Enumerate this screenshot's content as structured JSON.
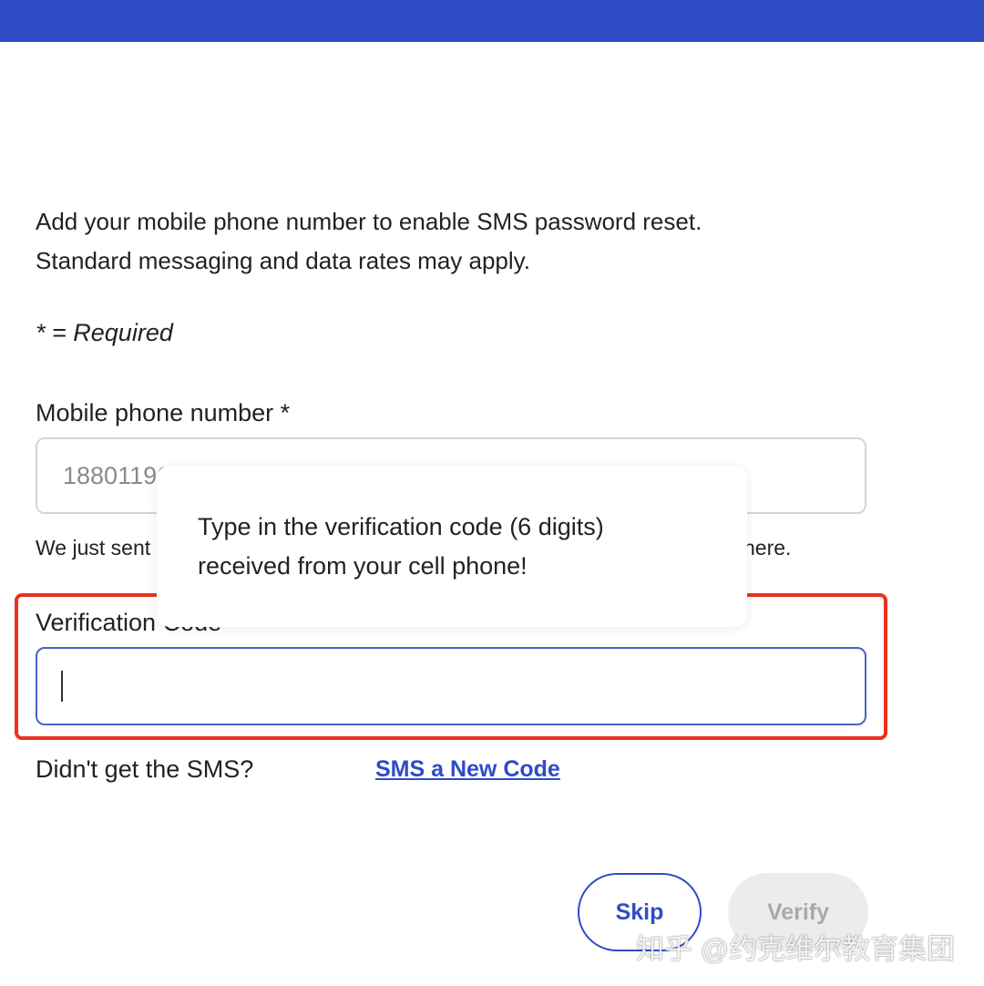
{
  "colors": {
    "brand": "#2f4cc5",
    "highlight": "#e8321f",
    "disabled_bg": "#ececec"
  },
  "intro": {
    "line1": "Add your mobile phone number to enable SMS password reset.",
    "line2": "Standard messaging and data rates may apply."
  },
  "required_note": "* = Required",
  "phone_field": {
    "label": "Mobile phone number *",
    "value": "18801196"
  },
  "hint": {
    "start": "We just sent",
    "end": "here."
  },
  "code_field": {
    "label": "Verification Code *",
    "value": ""
  },
  "tooltip": {
    "line1": "Type in the verification code (6 digits)",
    "line2": "received from your cell phone!"
  },
  "resend": {
    "question": "Didn't get the SMS?",
    "link": "SMS a New Code"
  },
  "buttons": {
    "skip": "Skip",
    "verify": "Verify"
  },
  "watermark": "知乎 @约克维尔教育集团"
}
